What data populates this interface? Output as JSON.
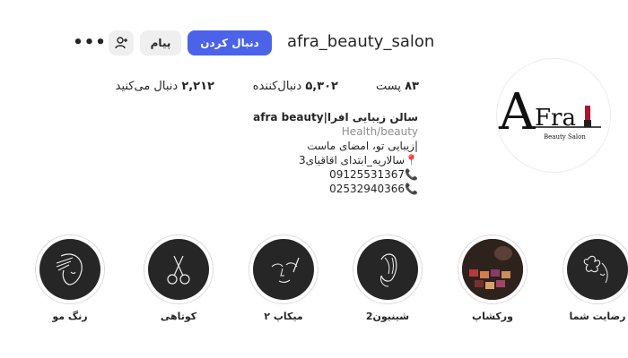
{
  "header": {
    "username": "afra_beauty_salon",
    "follow_label": "دنبال کردن",
    "message_label": "پیام",
    "more_icon": "more-dots-icon",
    "suggest_icon": "add-person-icon"
  },
  "stats": {
    "posts_count": "۸۳",
    "posts_label": "پست",
    "followers_count": "۵,۳۰۲",
    "followers_label": "دنبال‌کننده",
    "following_count": "۲,۲۱۲",
    "following_label": "دنبال می‌کنید"
  },
  "bio": {
    "name": "سالن زیبایی افرا|afra beauty",
    "category": "Health/beauty",
    "line1": "|زیبایی تو، امضای ماست",
    "line2": "سالاریه_ابتدای اقاقیای3",
    "phone1": "09125531367",
    "phone2": "02532940366"
  },
  "avatar": {
    "logo_text": "AFra",
    "logo_sub": "Beauty Salon"
  },
  "highlights": [
    {
      "label": "رنگ مو",
      "icon": "hair-color-icon"
    },
    {
      "label": "کوتاهی",
      "icon": "scissors-icon"
    },
    {
      "label": "میکاپ ۲",
      "icon": "makeup-face-icon"
    },
    {
      "label": "شینیون2",
      "icon": "hairstyle-icon"
    },
    {
      "label": "ورکشاپ",
      "icon": "workshop-photo-icon"
    },
    {
      "label": "رضایت شما",
      "icon": "flower-face-icon"
    }
  ],
  "colors": {
    "follow_button": "#4a63e8",
    "secondary_button": "#efefef",
    "highlight_bg": "#262626",
    "muted_text": "#8e8e8e"
  }
}
